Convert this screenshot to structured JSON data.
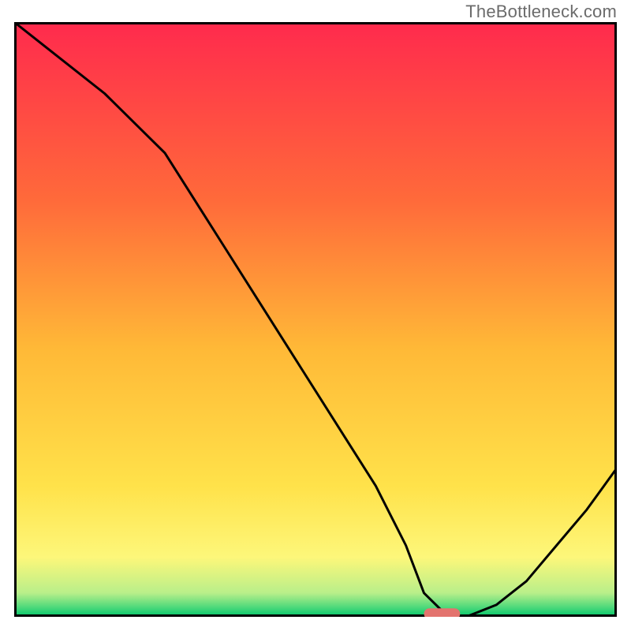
{
  "watermark": "TheBottleneck.com",
  "chart_data": {
    "type": "line",
    "title": "",
    "xlabel": "",
    "ylabel": "",
    "xlim": [
      0,
      100
    ],
    "ylim": [
      0,
      100
    ],
    "legend": null,
    "annotations": [],
    "background": {
      "type": "vertical_gradient",
      "stops": [
        {
          "pos": 0.0,
          "color": "#ff2a4d"
        },
        {
          "pos": 0.3,
          "color": "#ff6a3a"
        },
        {
          "pos": 0.55,
          "color": "#ffb937"
        },
        {
          "pos": 0.78,
          "color": "#ffe24a"
        },
        {
          "pos": 0.9,
          "color": "#fdf77a"
        },
        {
          "pos": 0.96,
          "color": "#b9ef8a"
        },
        {
          "pos": 0.985,
          "color": "#49d87a"
        },
        {
          "pos": 1.0,
          "color": "#00c46a"
        }
      ]
    },
    "series": [
      {
        "name": "bottleneck-curve",
        "x": [
          0,
          5,
          15,
          25,
          35,
          45,
          55,
          60,
          65,
          68,
          72,
          75,
          80,
          85,
          90,
          95,
          100
        ],
        "y": [
          100,
          96,
          88,
          78,
          62,
          46,
          30,
          22,
          12,
          4,
          0,
          0,
          2,
          6,
          12,
          18,
          25
        ]
      }
    ],
    "markers": [
      {
        "name": "optimal-range",
        "shape": "pill",
        "x": 71,
        "width": 6,
        "y": 0.5,
        "color": "#e3736e"
      }
    ],
    "frame": {
      "color": "#000000",
      "width": 3
    }
  }
}
